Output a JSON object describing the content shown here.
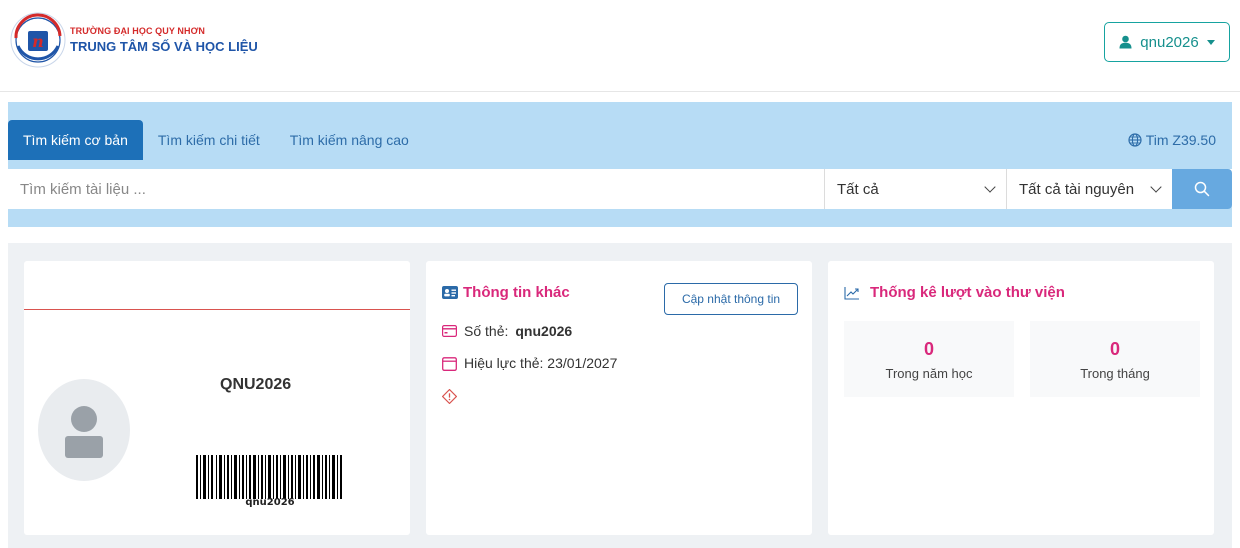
{
  "header": {
    "brand_top": "TRƯỜNG ĐẠI HỌC QUY NHƠN",
    "brand_main": "TRUNG TÂM SỐ VÀ HỌC LIỆU",
    "user_label": "qnu2026",
    "icons": [
      "logo",
      "user-icon",
      "caret-down-icon"
    ]
  },
  "search": {
    "tabs": [
      {
        "label": "Tìm kiếm cơ bản",
        "active": true
      },
      {
        "label": "Tìm kiếm chi tiết",
        "active": false
      },
      {
        "label": "Tìm kiếm nâng cao",
        "active": false
      }
    ],
    "tim_link": "Tim Z39.50",
    "placeholder": "Tìm kiếm tài liệu ...",
    "select_scope": "Tất cả",
    "select_resource": "Tất cả tài nguyên",
    "icons": [
      "globe-icon",
      "chevron-down-icon",
      "search-icon"
    ]
  },
  "profile": {
    "name": "QNU2026",
    "barcode_text": "qnu2026",
    "icons": [
      "avatar-placeholder",
      "barcode"
    ]
  },
  "other_info": {
    "title": "Thông tin khác",
    "update_button": "Cập nhật thông tin",
    "card_label": "Số thẻ:",
    "card_value": "qnu2026",
    "validity": "Hiệu lực thẻ: 23/01/2027",
    "icons": [
      "id-card-icon",
      "credit-card-icon",
      "calendar-icon",
      "warning-icon"
    ]
  },
  "stats": {
    "title": "Thống kê lượt vào thư viện",
    "items": [
      {
        "value": "0",
        "label": "Trong năm học"
      },
      {
        "value": "0",
        "label": "Trong tháng"
      }
    ],
    "icons": [
      "chart-line-icon"
    ]
  },
  "colors": {
    "accent_teal": "#16908d",
    "primary_blue": "#1d70b8",
    "band_bg": "#b7dcf5",
    "pink": "#d9287b",
    "red_line": "#d9534f"
  }
}
